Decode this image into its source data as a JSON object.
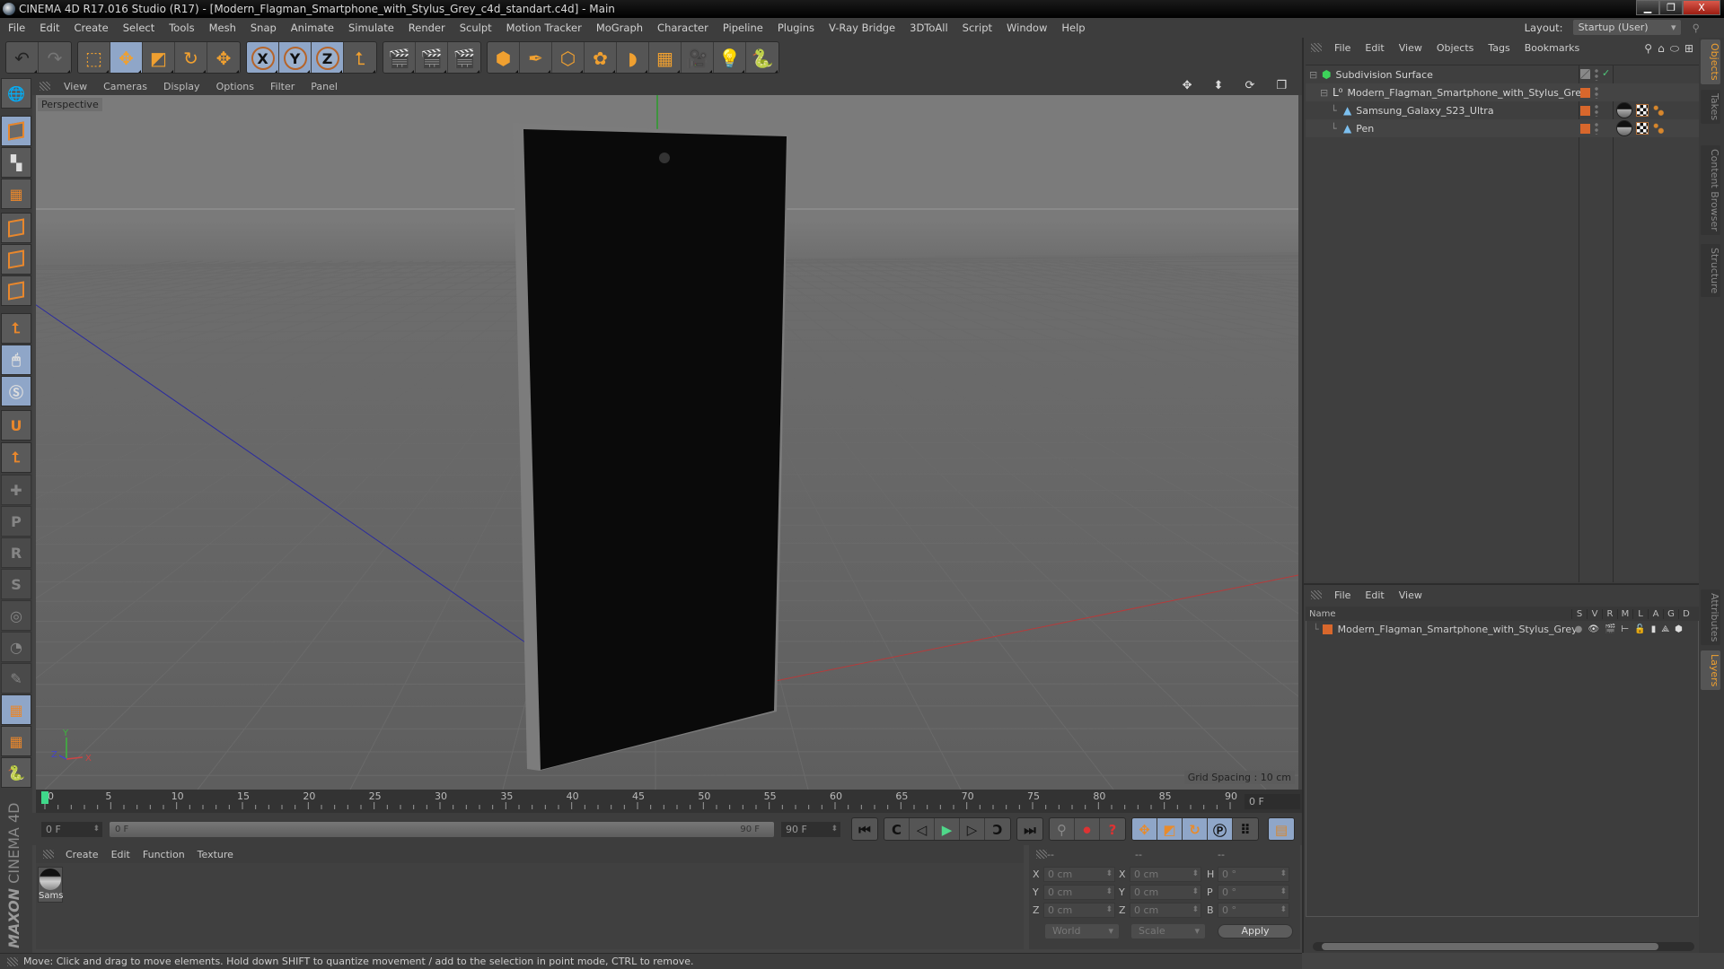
{
  "window": {
    "title": "CINEMA 4D R17.016 Studio (R17) - [Modern_Flagman_Smartphone_with_Stylus_Grey_c4d_standart.c4d] - Main",
    "controls": [
      "minimize",
      "restore",
      "close"
    ],
    "close_glyph": "X",
    "min_glyph": "▁",
    "restore_glyph": "❐"
  },
  "menubar": {
    "items": [
      "File",
      "Edit",
      "Create",
      "Select",
      "Tools",
      "Mesh",
      "Snap",
      "Animate",
      "Simulate",
      "Render",
      "Sculpt",
      "Motion Tracker",
      "MoGraph",
      "Character",
      "Pipeline",
      "Plugins",
      "V-Ray Bridge",
      "3DToAll",
      "Script",
      "Window",
      "Help"
    ],
    "layout_label": "Layout:",
    "layout_value": "Startup (User)"
  },
  "toolbar": {
    "groups": [
      [
        {
          "icon": "undo-icon",
          "glyph": "↶"
        },
        {
          "icon": "redo-icon",
          "glyph": "↷"
        }
      ],
      [
        {
          "icon": "live-selection-icon",
          "glyph": "⬚"
        },
        {
          "icon": "move-icon",
          "glyph": "✥",
          "active": true
        },
        {
          "icon": "scale-icon",
          "glyph": "◩"
        },
        {
          "icon": "rotate-icon",
          "glyph": "↻"
        },
        {
          "icon": "transform-icon",
          "glyph": "✥"
        }
      ],
      [
        {
          "icon": "x-axis-icon",
          "glyph": "X",
          "axis": true
        },
        {
          "icon": "y-axis-icon",
          "glyph": "Y",
          "axis": true
        },
        {
          "icon": "z-axis-icon",
          "glyph": "Z",
          "axis": true
        },
        {
          "icon": "coordinate-system-icon",
          "glyph": "⮤"
        }
      ],
      [
        {
          "icon": "render-view-icon",
          "glyph": "🎬"
        },
        {
          "icon": "render-picture-viewer-icon",
          "glyph": "🎬"
        },
        {
          "icon": "render-settings-icon",
          "glyph": "🎬"
        }
      ],
      [
        {
          "icon": "cube-object-icon",
          "glyph": "⬢"
        },
        {
          "icon": "pen-spline-icon",
          "glyph": "✒"
        },
        {
          "icon": "subdivision-surface-icon",
          "glyph": "⬡"
        },
        {
          "icon": "cloner-icon",
          "glyph": "✿"
        },
        {
          "icon": "deformer-icon",
          "glyph": "◗"
        },
        {
          "icon": "floor-icon",
          "glyph": "▦"
        },
        {
          "icon": "camera-icon",
          "glyph": "🎥"
        },
        {
          "icon": "light-icon",
          "glyph": "💡"
        },
        {
          "icon": "python-icon",
          "glyph": "🐍"
        }
      ]
    ]
  },
  "left_toolbar": {
    "items": [
      {
        "icon": "make-editable-icon"
      },
      {
        "icon": "model-mode-icon",
        "active": true
      },
      {
        "icon": "texture-mode-icon"
      },
      {
        "icon": "workplane-mode-icon"
      },
      {
        "icon": "points-mode-icon"
      },
      {
        "icon": "edges-mode-icon"
      },
      {
        "icon": "polygons-mode-icon"
      },
      {
        "icon": "axis-mode-icon"
      },
      {
        "icon": "tweak-mode-icon",
        "active": true
      },
      {
        "icon": "solo-mode-icon",
        "active": true
      },
      {
        "icon": "snap-magnet-icon"
      },
      {
        "icon": "workplane-axis-icon"
      },
      {
        "icon": "add-keyframe-icon",
        "dim": true
      },
      {
        "icon": "position-key-icon",
        "dim": true
      },
      {
        "icon": "rotation-key-icon",
        "dim": true
      },
      {
        "icon": "psr-key-icon",
        "dim": true
      },
      {
        "icon": "point-level-key-icon",
        "dim": true
      },
      {
        "icon": "param-key-icon",
        "dim": true
      },
      {
        "icon": "auto-key-icon",
        "dim": true
      },
      {
        "icon": "locked-workplane-icon",
        "active": true
      },
      {
        "icon": "planar-workplane-icon"
      },
      {
        "icon": "python-icon"
      }
    ]
  },
  "viewport": {
    "menu": [
      "View",
      "Cameras",
      "Display",
      "Options",
      "Filter",
      "Panel"
    ],
    "camera_label": "Perspective",
    "grid_spacing": "Grid Spacing : 10 cm",
    "nav_icons": [
      "move-view-icon",
      "zoom-view-icon",
      "rotate-view-icon",
      "maximize-view-icon"
    ],
    "axis_labels": {
      "x": "X",
      "y": "Y",
      "z": "Z"
    }
  },
  "timeline": {
    "ticks": [
      "0",
      "5",
      "10",
      "15",
      "20",
      "25",
      "30",
      "35",
      "40",
      "45",
      "50",
      "55",
      "60",
      "65",
      "70",
      "75",
      "80",
      "85",
      "90"
    ],
    "current_frame": "0 F",
    "start_field": "0 F",
    "range_start": "0 F",
    "range_end": "90 F",
    "end_field": "90 F",
    "playhead_fraction": 0.0
  },
  "playback": {
    "transport": [
      "goto-start-icon",
      "prev-key-icon",
      "prev-frame-icon",
      "play-icon",
      "next-frame-icon",
      "next-key-icon",
      "goto-end-icon"
    ],
    "record": [
      "motion-record-icon",
      "autokey-icon",
      "keyframe-selection-icon"
    ],
    "tracks": [
      "position-track-icon",
      "scale-track-icon",
      "rotation-track-icon",
      "parameter-track-icon",
      "point-level-icon"
    ],
    "timeline_icon": "timeline-window-icon"
  },
  "materials": {
    "menu": [
      "Create",
      "Edit",
      "Function",
      "Texture"
    ],
    "items": [
      {
        "name": "Sams"
      }
    ]
  },
  "branding": {
    "maxon": "MAXON",
    "product": "CINEMA 4D"
  },
  "coordinates": {
    "headers": [
      "--",
      "--",
      "--"
    ],
    "rows": [
      {
        "l1": "X",
        "v1": "0 cm",
        "l2": "X",
        "v2": "0 cm",
        "l3": "H",
        "v3": "0 °"
      },
      {
        "l1": "Y",
        "v1": "0 cm",
        "l2": "Y",
        "v2": "0 cm",
        "l3": "P",
        "v3": "0 °"
      },
      {
        "l1": "Z",
        "v1": "0 cm",
        "l2": "Z",
        "v2": "0 cm",
        "l3": "B",
        "v3": "0 °"
      }
    ],
    "space": "World",
    "mode": "Scale",
    "apply": "Apply"
  },
  "status": "Move: Click and drag to move elements. Hold down SHIFT to quantize movement / add to the selection in point mode, CTRL to remove.",
  "objects": {
    "menu": [
      "File",
      "Edit",
      "View",
      "Objects",
      "Tags",
      "Bookmarks"
    ],
    "tree": [
      {
        "name": "Subdivision Surface",
        "depth": 0,
        "icon": "subdivision-surface-icon",
        "expander": "⊟",
        "enabled": true
      },
      {
        "name": "Modern_Flagman_Smartphone_with_Stylus_Grey",
        "depth": 1,
        "icon": "null-object-icon",
        "expander": "⊟",
        "color": "#d8672c"
      },
      {
        "name": "Samsung_Galaxy_S23_Ultra",
        "depth": 2,
        "icon": "polygon-object-icon",
        "color": "#d8672c",
        "tags": [
          "material-tag",
          "texture-tag",
          "vertex-tag"
        ]
      },
      {
        "name": "Pen",
        "depth": 2,
        "icon": "polygon-object-icon",
        "color": "#d8672c",
        "tags": [
          "material-tag",
          "texture-tag",
          "vertex-tag"
        ]
      }
    ]
  },
  "layers": {
    "menu": [
      "File",
      "Edit",
      "View"
    ],
    "columns": [
      "Name",
      "S",
      "V",
      "R",
      "M",
      "L",
      "A",
      "G",
      "D"
    ],
    "rows": [
      {
        "name": "Modern_Flagman_Smartphone_with_Stylus_Grey",
        "color": "#d8672c"
      }
    ]
  },
  "side_tabs": {
    "top": [
      {
        "label": "Objects",
        "active": true
      },
      {
        "label": "Takes"
      },
      {
        "label": "Content Browser"
      },
      {
        "label": "Structure"
      }
    ],
    "bottom": [
      {
        "label": "Attributes"
      },
      {
        "label": "Layers",
        "active": true
      }
    ]
  }
}
